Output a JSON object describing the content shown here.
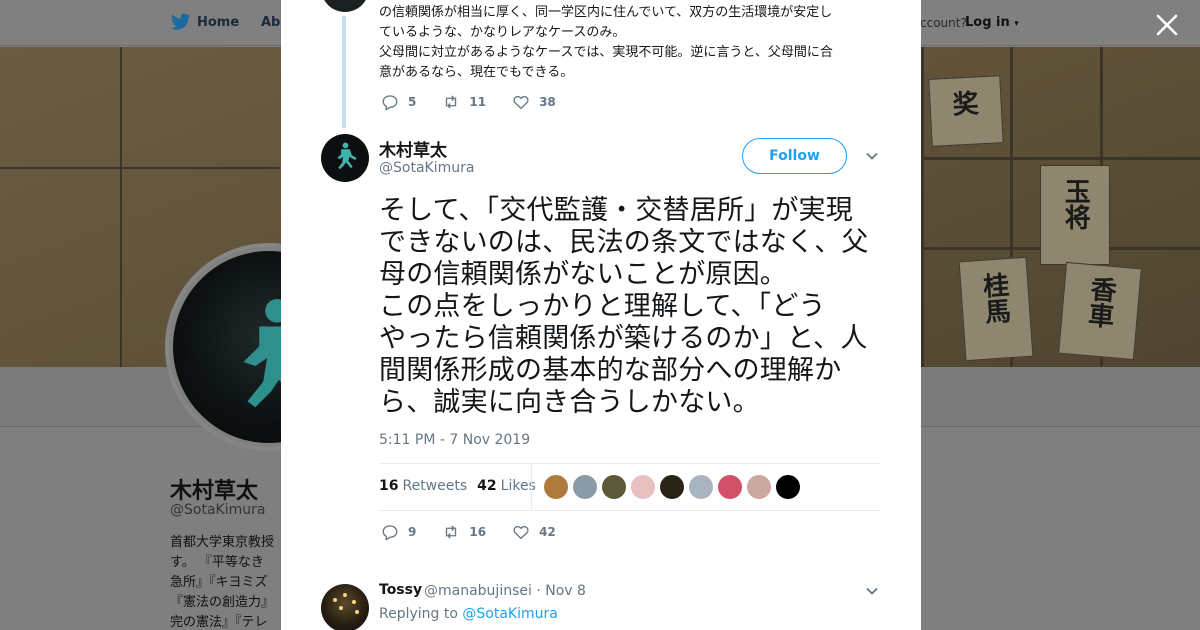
{
  "nav": {
    "home_label": "Home",
    "about_label": "Abo",
    "account_prompt": "ccount?",
    "login_label": "Log in"
  },
  "profile": {
    "name": "木村草太",
    "handle": "@SotaKimura",
    "bio": "首都大学東京教授\nす。 『平等なき\n急所』『キヨミズ\n『憲法の創造力』\n完の憲法』『テレ"
  },
  "banner_pieces": [
    "奖",
    "玉将",
    "桂馬",
    "香車"
  ],
  "previous_tweet": {
    "text": "の信頼関係が相当に厚く、同一学区内に住んでいて、双方の生活環境が安定し\nているような、かなりレアなケースのみ。\n父母間に対立があるようなケースでは、実現不可能。逆に言うと、父母間に合\n意があるなら、現在でもできる。",
    "replies": "5",
    "retweets": "11",
    "likes": "38"
  },
  "tweet": {
    "author_name": "木村草太",
    "author_handle": "@SotaKimura",
    "follow_label": "Follow",
    "text": "そして、「交代監護・交替居所」が実現\nできないのは、民法の条文ではなく、父\n母の信頼関係がないことが原因。\nこの点をしっかりと理解して、「どう\nやったら信頼関係が築けるのか」と、人\n間関係形成の基本的な部分への理解か\nら、誠実に向き合うしかない。",
    "timestamp": "5:11 PM - 7 Nov 2019",
    "retweet_count": "16",
    "retweet_label": "Retweets",
    "like_count": "42",
    "like_label": "Likes",
    "replies": "9",
    "retweets": "16",
    "likes": "42"
  },
  "likers": [
    "#b07a3c",
    "#8a9aa6",
    "#5a5a3a",
    "#e8c0c0",
    "#2a2418",
    "#a8b4bf",
    "#d44f6a",
    "#c9a8a0",
    "#000000"
  ],
  "reply": {
    "name": "Tossy",
    "meta": "@manabujinsei · Nov 8",
    "replying_prefix": "Replying to ",
    "replying_handle": "@SotaKimura"
  },
  "colors": {
    "accent": "#1da1f2",
    "muted": "#657786",
    "overlay": "#7f7f7f"
  },
  "icons": [
    "twitter-bird-icon",
    "close-icon",
    "reply-icon",
    "retweet-icon",
    "like-icon",
    "chevron-down-icon"
  ]
}
